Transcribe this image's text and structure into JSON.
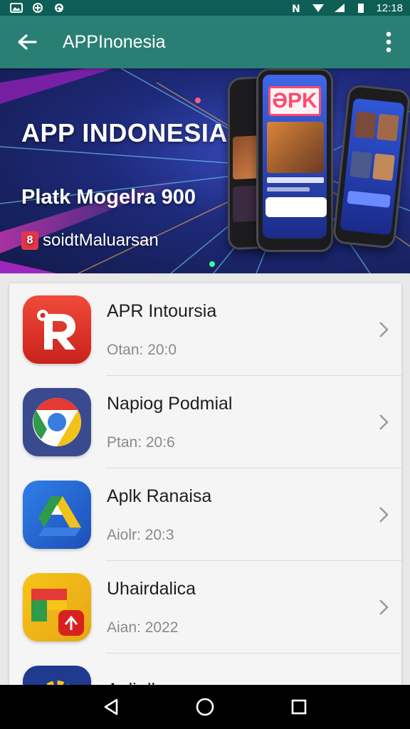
{
  "status_bar": {
    "time": "12:18",
    "left_icons": [
      "image-notification-icon",
      "vpn-icon",
      "sync-icon"
    ],
    "right_icons": [
      "nfc-icon",
      "wifi-icon",
      "signal-icon",
      "battery-icon"
    ]
  },
  "app_bar": {
    "title": "APPInonesia",
    "back_icon": "arrow-left-icon",
    "menu_icon": "more-vert-icon"
  },
  "banner": {
    "title": "APP INDONESIA",
    "subtitle": "Platk Mogelra 900",
    "badge_text": "soidtMaluarsan",
    "phone_screen_label": "ƏPK"
  },
  "apps": [
    {
      "name": "APR Intoursia",
      "meta": "Otan: 20:0",
      "icon": "red-r-app-icon"
    },
    {
      "name": "Napiog Podmial",
      "meta": "Ptan: 20:6",
      "icon": "chrome-style-app-icon"
    },
    {
      "name": "Aplk Ranaisa",
      "meta": "Aiolr: 20:3",
      "icon": "drive-style-app-icon"
    },
    {
      "name": "Uhairdalica",
      "meta": "Aian: 2022",
      "icon": "yellow-green-app-icon"
    },
    {
      "name": "Aulir lhaa",
      "meta": "",
      "icon": "settings-gear-app-icon"
    }
  ],
  "colors": {
    "status_bar": "#0e5e55",
    "app_bar": "#2a7f74",
    "nav_bar": "#000000"
  },
  "nav": {
    "back": "nav-back-icon",
    "home": "nav-home-icon",
    "recents": "nav-recents-icon"
  }
}
